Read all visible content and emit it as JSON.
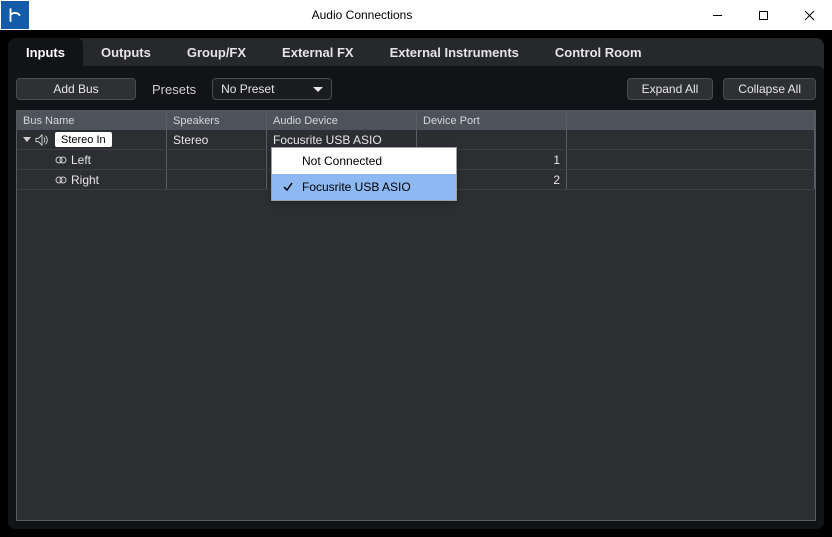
{
  "window": {
    "title": "Audio Connections",
    "controls": {
      "minimize": "—",
      "maximize": "▢",
      "close": "✕"
    }
  },
  "tabs": {
    "items": [
      {
        "label": "Inputs",
        "active": true
      },
      {
        "label": "Outputs",
        "active": false
      },
      {
        "label": "Group/FX",
        "active": false
      },
      {
        "label": "External FX",
        "active": false
      },
      {
        "label": "External Instruments",
        "active": false
      },
      {
        "label": "Control Room",
        "active": false
      }
    ]
  },
  "toolbar": {
    "add_bus_label": "Add Bus",
    "presets_label": "Presets",
    "preset_select_value": "No Preset",
    "expand_all_label": "Expand All",
    "collapse_all_label": "Collapse All"
  },
  "columns": {
    "bus_name": "Bus Name",
    "speakers": "Speakers",
    "audio_device": "Audio Device",
    "device_port": "Device Port"
  },
  "rows": {
    "bus": {
      "name": "Stereo In",
      "speakers": "Stereo",
      "audio_device": "Focusrite USB ASIO"
    },
    "children": [
      {
        "name": "Left",
        "port_suffix": "1"
      },
      {
        "name": "Right",
        "port_suffix": "2"
      }
    ]
  },
  "dropdown": {
    "items": [
      {
        "label": "Not Connected",
        "selected": false
      },
      {
        "label": "Focusrite USB ASIO",
        "selected": true
      }
    ]
  }
}
